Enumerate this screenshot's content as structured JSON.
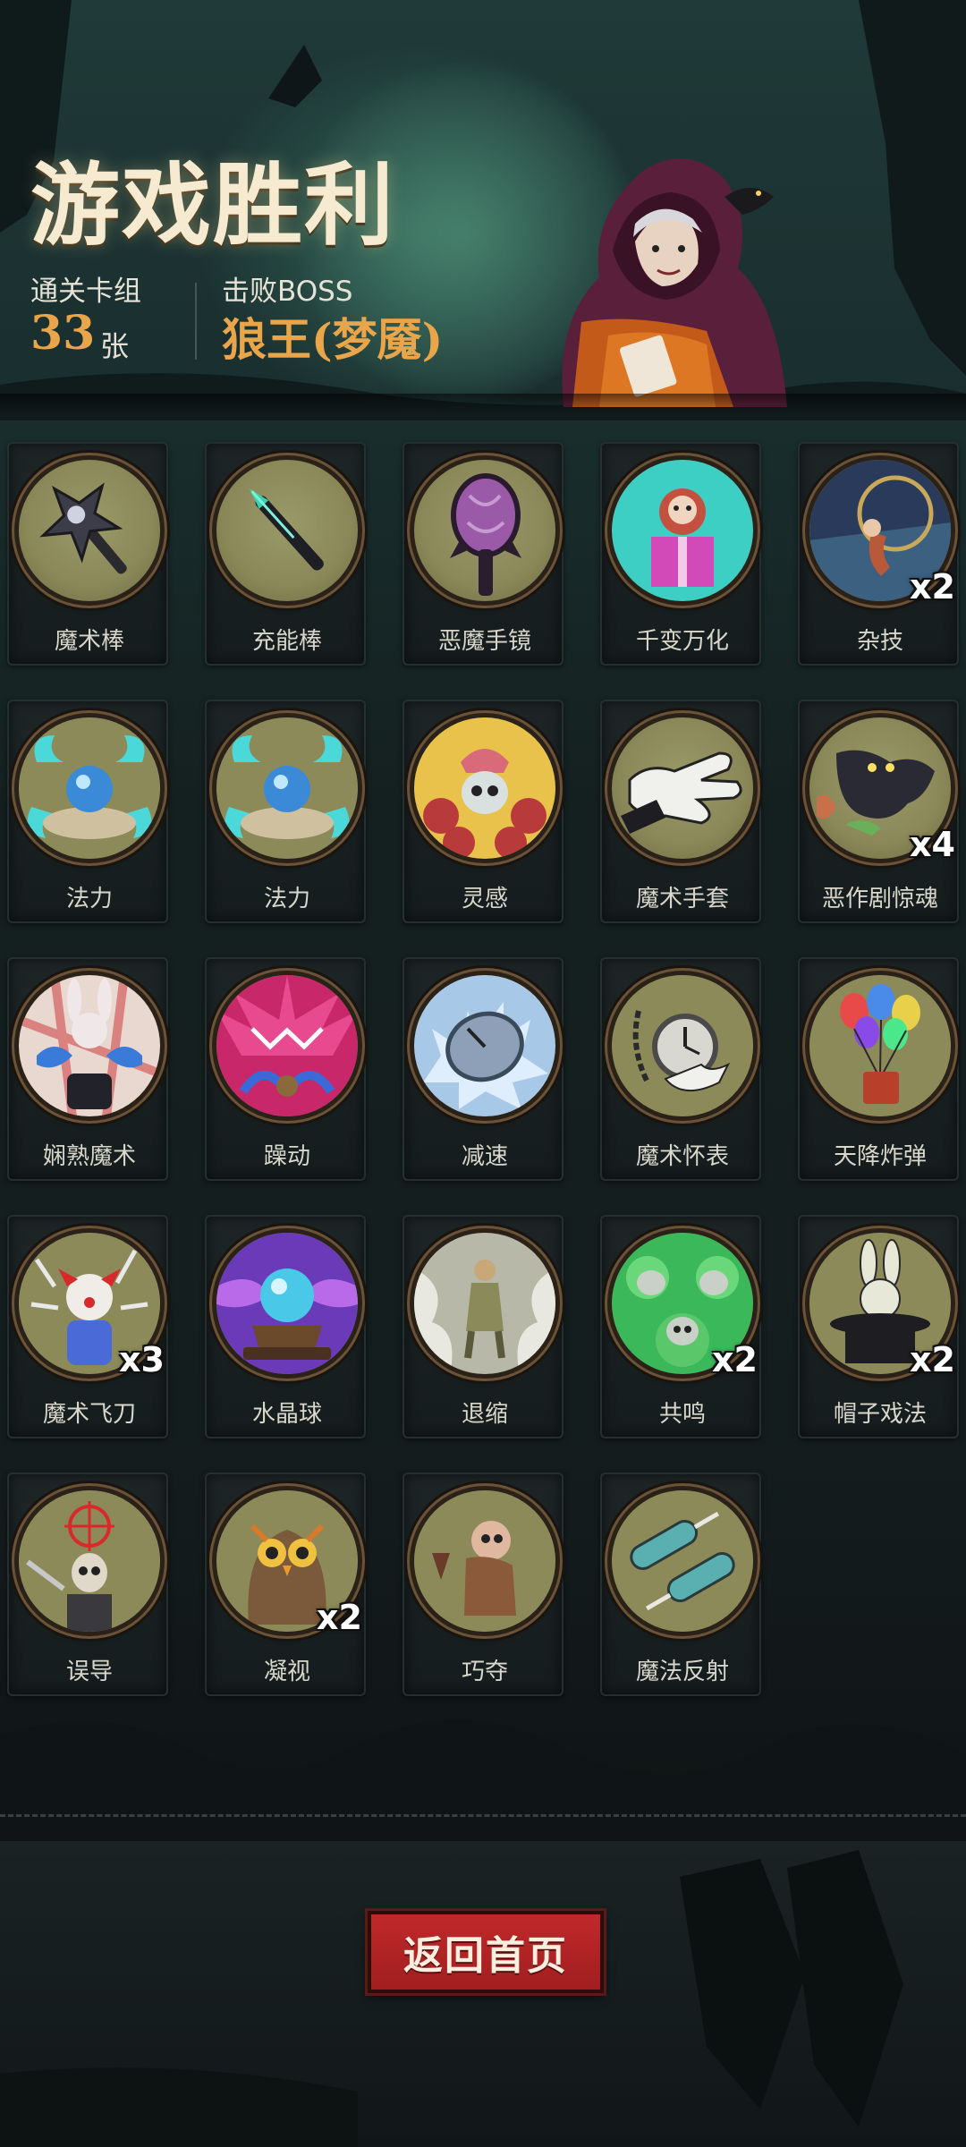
{
  "header": {
    "title": "游戏胜利",
    "deck_label": "通关卡组",
    "deck_count": "33",
    "deck_unit": "张",
    "boss_label": "击败BOSS",
    "boss_name": "狼王(梦魇)"
  },
  "cards": [
    {
      "label": "魔术棒",
      "icon": "wand-icon",
      "badge": ""
    },
    {
      "label": "充能棒",
      "icon": "charge-rod-icon",
      "badge": ""
    },
    {
      "label": "恶魔手镜",
      "icon": "demon-mirror-icon",
      "badge": ""
    },
    {
      "label": "千变万化",
      "icon": "gift-box-icon",
      "badge": ""
    },
    {
      "label": "杂技",
      "icon": "acrobat-icon",
      "badge": "x2"
    },
    {
      "label": "法力",
      "icon": "mana-orb-icon",
      "badge": ""
    },
    {
      "label": "法力",
      "icon": "mana-orb-icon",
      "badge": ""
    },
    {
      "label": "灵感",
      "icon": "brain-skull-icon",
      "badge": ""
    },
    {
      "label": "魔术手套",
      "icon": "magic-glove-icon",
      "badge": ""
    },
    {
      "label": "恶作剧惊魂",
      "icon": "prank-cat-icon",
      "badge": "x4"
    },
    {
      "label": "娴熟魔术",
      "icon": "rabbit-magician-icon",
      "badge": ""
    },
    {
      "label": "躁动",
      "icon": "frenzy-icon",
      "badge": ""
    },
    {
      "label": "减速",
      "icon": "frozen-clock-icon",
      "badge": ""
    },
    {
      "label": "魔术怀表",
      "icon": "pocket-watch-icon",
      "badge": ""
    },
    {
      "label": "天降炸弹",
      "icon": "balloon-bomb-icon",
      "badge": ""
    },
    {
      "label": "魔术飞刀",
      "icon": "clown-knives-icon",
      "badge": "x3"
    },
    {
      "label": "水晶球",
      "icon": "crystal-ball-icon",
      "badge": ""
    },
    {
      "label": "退缩",
      "icon": "retreat-icon",
      "badge": ""
    },
    {
      "label": "共鸣",
      "icon": "resonance-skull-icon",
      "badge": "x2"
    },
    {
      "label": "帽子戏法",
      "icon": "hat-rabbit-icon",
      "badge": "x2"
    },
    {
      "label": "误导",
      "icon": "target-skeleton-icon",
      "badge": ""
    },
    {
      "label": "凝视",
      "icon": "owl-icon",
      "badge": "x2"
    },
    {
      "label": "巧夺",
      "icon": "thief-icon",
      "badge": ""
    },
    {
      "label": "魔法反射",
      "icon": "reflect-icon",
      "badge": ""
    }
  ],
  "footer": {
    "home_button": "返回首页"
  },
  "colors": {
    "accent_gold": "#e9a54a",
    "button_red": "#c0292b",
    "title_cream": "#f6ead0"
  }
}
